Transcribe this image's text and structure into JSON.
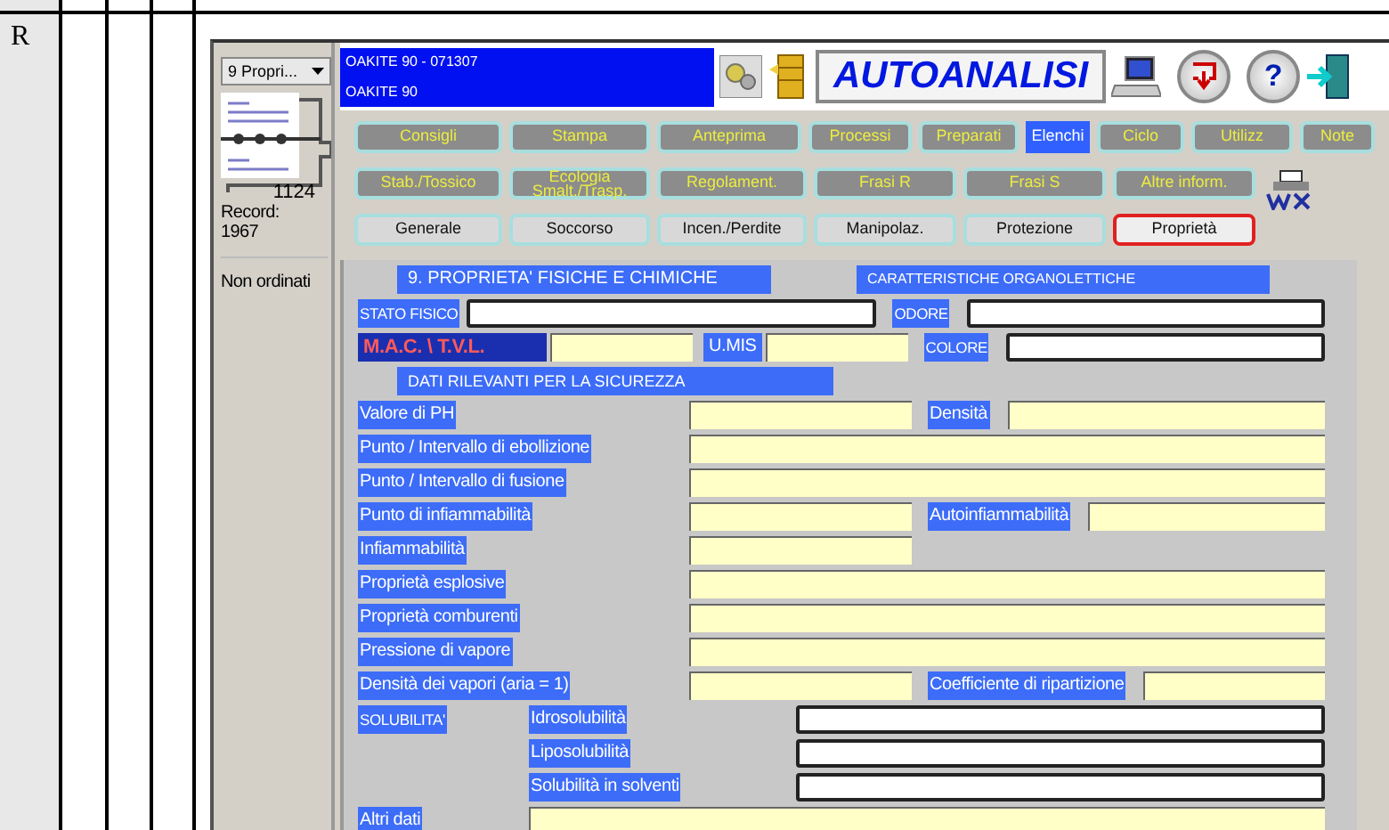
{
  "outer_table": {
    "row_label": "R"
  },
  "sidebar": {
    "dropdown": "9 Propri...",
    "record_count": "1124",
    "record_label": "Record:",
    "record_number": "1967",
    "sort_status": "Non ordinati"
  },
  "header": {
    "product_code": "OAKITE 90 - 071307",
    "product_name": "OAKITE 90",
    "title": "AUTOANALISI",
    "help_button": "?"
  },
  "tab_rows": [
    {
      "kind": "secondary",
      "tabs": [
        {
          "label": "Consigli",
          "selected": false,
          "highlighted": false
        },
        {
          "label": "Stampa",
          "selected": false,
          "highlighted": false
        },
        {
          "label": "Anteprima",
          "selected": false,
          "highlighted": false
        },
        {
          "label": "Processi",
          "selected": false,
          "highlighted": false
        },
        {
          "label": "Preparati",
          "selected": false,
          "highlighted": false
        },
        {
          "label": "Elenchi",
          "selected": false,
          "highlighted": true
        },
        {
          "label": "Ciclo",
          "selected": false,
          "highlighted": false
        },
        {
          "label": "Utilizz",
          "selected": false,
          "highlighted": false
        },
        {
          "label": "Note",
          "selected": false,
          "highlighted": false
        }
      ]
    },
    {
      "kind": "secondary",
      "tabs": [
        {
          "label": "Stab./Tossico",
          "selected": false,
          "highlighted": false
        },
        {
          "label": "Ecologia Smalt./Trasp.",
          "selected": false,
          "highlighted": false
        },
        {
          "label": "Regolament.",
          "selected": false,
          "highlighted": false
        },
        {
          "label": "Frasi R",
          "selected": false,
          "highlighted": false
        },
        {
          "label": "Frasi S",
          "selected": false,
          "highlighted": false
        },
        {
          "label": "Altre inform.",
          "selected": false,
          "highlighted": false
        }
      ]
    },
    {
      "kind": "primary",
      "tabs": [
        {
          "label": "Generale",
          "selected": false,
          "highlighted": false
        },
        {
          "label": "Soccorso",
          "selected": false,
          "highlighted": false
        },
        {
          "label": "Incen./Perdite",
          "selected": false,
          "highlighted": false
        },
        {
          "label": "Manipolaz.",
          "selected": false,
          "highlighted": false
        },
        {
          "label": "Protezione",
          "selected": false,
          "highlighted": false
        },
        {
          "label": "Proprietà",
          "selected": true,
          "highlighted": false
        }
      ]
    }
  ],
  "form": {
    "headings": [
      "9. PROPRIETA' FISICHE E CHIMICHE",
      "CARATTERISTICHE ORGANOLETTICHE"
    ],
    "rows": [
      {
        "kind": "organoleptic",
        "label": "STATO FISICO",
        "label2": "ODORE"
      },
      {
        "kind": "mac",
        "label": "M.A.C. \\ T.V.L.",
        "unit": "U.MIS",
        "label2": "COLORE"
      },
      {
        "kind": "subheading",
        "label": "DATI RILEVANTI PER LA SICUREZZA"
      },
      {
        "kind": "split",
        "label": "Valore di PH",
        "label2": "Densità"
      },
      {
        "kind": "full",
        "label": "Punto / Intervallo di ebollizione"
      },
      {
        "kind": "full",
        "label": "Punto / Intervallo di fusione"
      },
      {
        "kind": "split",
        "label": "Punto di infiammabilità",
        "label2": "Autoinfiammabilità"
      },
      {
        "kind": "short",
        "label": "Infiammabilità"
      },
      {
        "kind": "full",
        "label": "Proprietà esplosive"
      },
      {
        "kind": "full",
        "label": "Proprietà comburenti"
      },
      {
        "kind": "full",
        "label": "Pressione di vapore"
      },
      {
        "kind": "split",
        "label": "Densità dei vapori (aria = 1)",
        "label2": "Coefficiente di ripartizione"
      },
      {
        "kind": "solubility",
        "group": "SOLUBILITA'",
        "label": "Idrosolubilità"
      },
      {
        "kind": "solubility",
        "label": "Liposolubilità"
      },
      {
        "kind": "solubility",
        "label": "Solubilità in solventi"
      },
      {
        "kind": "other",
        "label": "Altri dati"
      }
    ]
  }
}
